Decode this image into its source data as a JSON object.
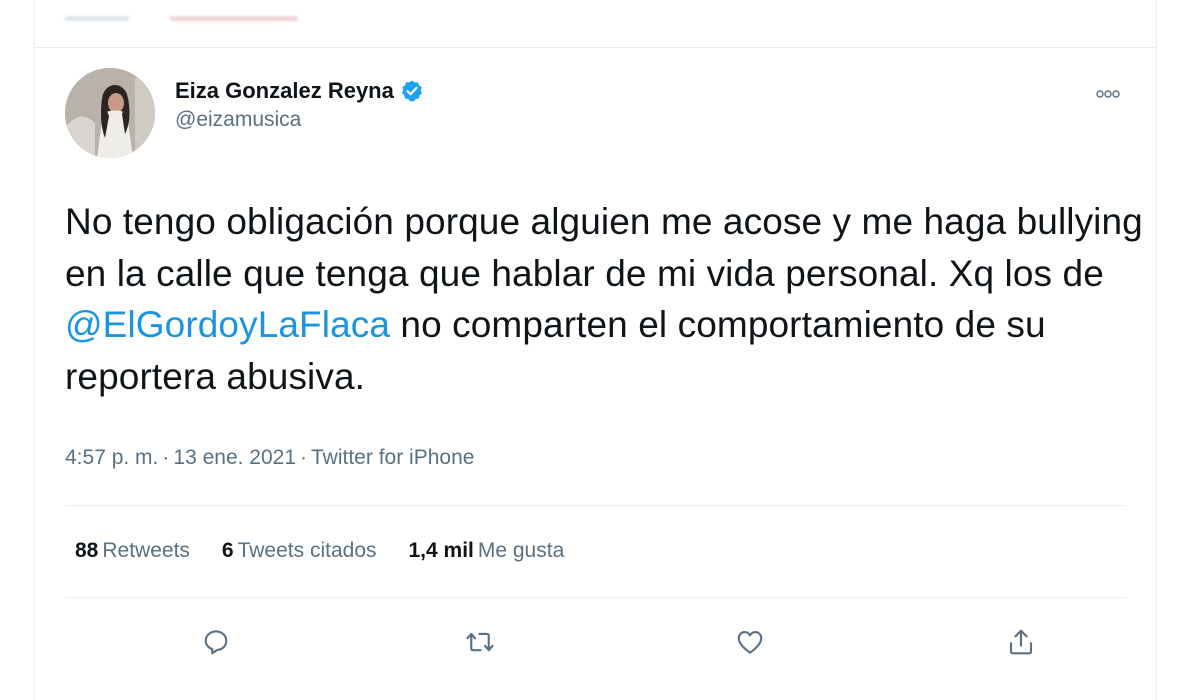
{
  "header": {
    "display_name": "Eiza Gonzalez Reyna",
    "handle": "@eizamusica"
  },
  "tweet": {
    "text_before": "No tengo obligación porque alguien me acose y me haga bullying en la calle que tenga que hablar de mi vida personal. Xq los de ",
    "mention": "@ElGordoyLaFlaca",
    "text_after": " no comparten el comportamiento de su reportera abusiva."
  },
  "meta": {
    "time": "4:57 p. m.",
    "date": "13 ene. 2021",
    "source": "Twitter for iPhone",
    "separator": "·"
  },
  "stats": {
    "retweets_count": "88",
    "retweets_label": "Retweets",
    "quotes_count": "6",
    "quotes_label": "Tweets citados",
    "likes_count": "1,4 mil",
    "likes_label": "Me gusta"
  },
  "actions": [
    {
      "icon": "reply-icon"
    },
    {
      "icon": "retweet-icon"
    },
    {
      "icon": "like-icon"
    },
    {
      "icon": "share-icon"
    }
  ],
  "colors": {
    "text": "#0f1419",
    "secondary": "#5b7083",
    "link": "#1b95e0",
    "verified": "#1da1f2",
    "divider": "#e6ecf0"
  }
}
